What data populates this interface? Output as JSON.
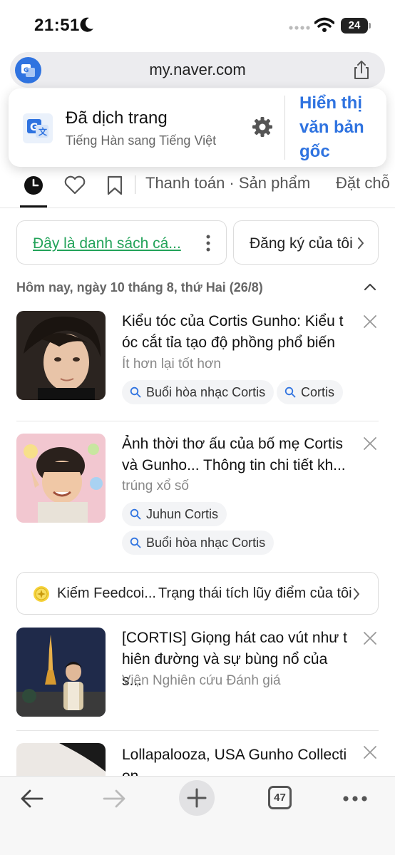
{
  "status_bar": {
    "time": "21:51",
    "battery": "24"
  },
  "url_bar": {
    "url": "my.naver.com"
  },
  "translate_popup": {
    "title": "Đã dịch trang",
    "subtitle": "Tiếng Hàn sang Tiếng Việt",
    "show_original_lines": [
      "Hiển thị",
      "văn bản",
      "gốc"
    ]
  },
  "tabs": {
    "labels": [
      "Thanh toán · Sản phẩm",
      "Đặt chỗ"
    ]
  },
  "chips": {
    "list_label": "Đây là danh sách cá...",
    "register_label": "Đăng ký của tôi"
  },
  "date_header": "Hôm nay, ngày 10 tháng 8, thứ Hai (26/8)",
  "feed": [
    {
      "title_lines": [
        "Kiểu tóc của Cortis Gunho: Kiểu t",
        "óc cắt tỉa tạo độ phồng phổ biến"
      ],
      "source": "Ít hơn lại tốt hơn",
      "tags": [
        "Buổi hòa nhạc Cortis",
        "Cortis"
      ]
    },
    {
      "title_lines": [
        "Ảnh thời thơ ấu của bố mẹ Cortis",
        "và Gunho... Thông tin chi tiết kh..."
      ],
      "source": "trúng xổ số",
      "tags": [
        "Juhun Cortis",
        "Buổi hòa nhạc Cortis"
      ]
    },
    {
      "title_lines": [
        "[CORTIS] Giọng hát cao vút như t",
        "hiên đường và sự bùng nổ của s..."
      ],
      "source": "Viện Nghiên cứu Đánh giá",
      "tags": []
    },
    {
      "title_lines": [
        "Lollapalooza, USA Gunho Collecti",
        "on"
      ],
      "source": "",
      "tags": []
    }
  ],
  "coin_banner": {
    "left_text": "Kiếm Feedcoi...",
    "right_text": "Trạng thái tích lũy điểm của tôi"
  },
  "toolbar": {
    "tab_count": "47"
  },
  "colors": {
    "accent": "#2f73e0",
    "link_green": "#23a35a"
  }
}
